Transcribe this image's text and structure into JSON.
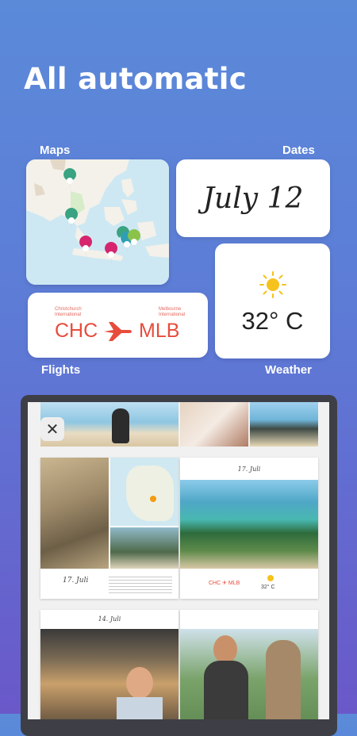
{
  "headline": "All automatic",
  "labels": {
    "maps": "Maps",
    "dates": "Dates",
    "flights": "Flights",
    "weather": "Weather"
  },
  "date_card": {
    "value": "July 12"
  },
  "weather_card": {
    "temperature": "32° C",
    "icon": "sun-icon"
  },
  "flight_card": {
    "from_code": "CHC",
    "to_code": "MLB",
    "from_airport": "Christchurch International",
    "to_airport": "Melbourne International",
    "icon": "airplane-icon"
  },
  "book_preview": {
    "page_date_top": "17. Juli",
    "page_date_left": "17. Juli",
    "page_date_bottom": "14. Juli",
    "mini_flight": "CHC ✈ MLB",
    "mini_temp": "32° C"
  },
  "close_icon": "close-icon",
  "colors": {
    "flight_red": "#e74c3c",
    "pin_green": "#3aa381",
    "pin_pink": "#d6246e",
    "sun_yellow": "#f6c21c"
  }
}
